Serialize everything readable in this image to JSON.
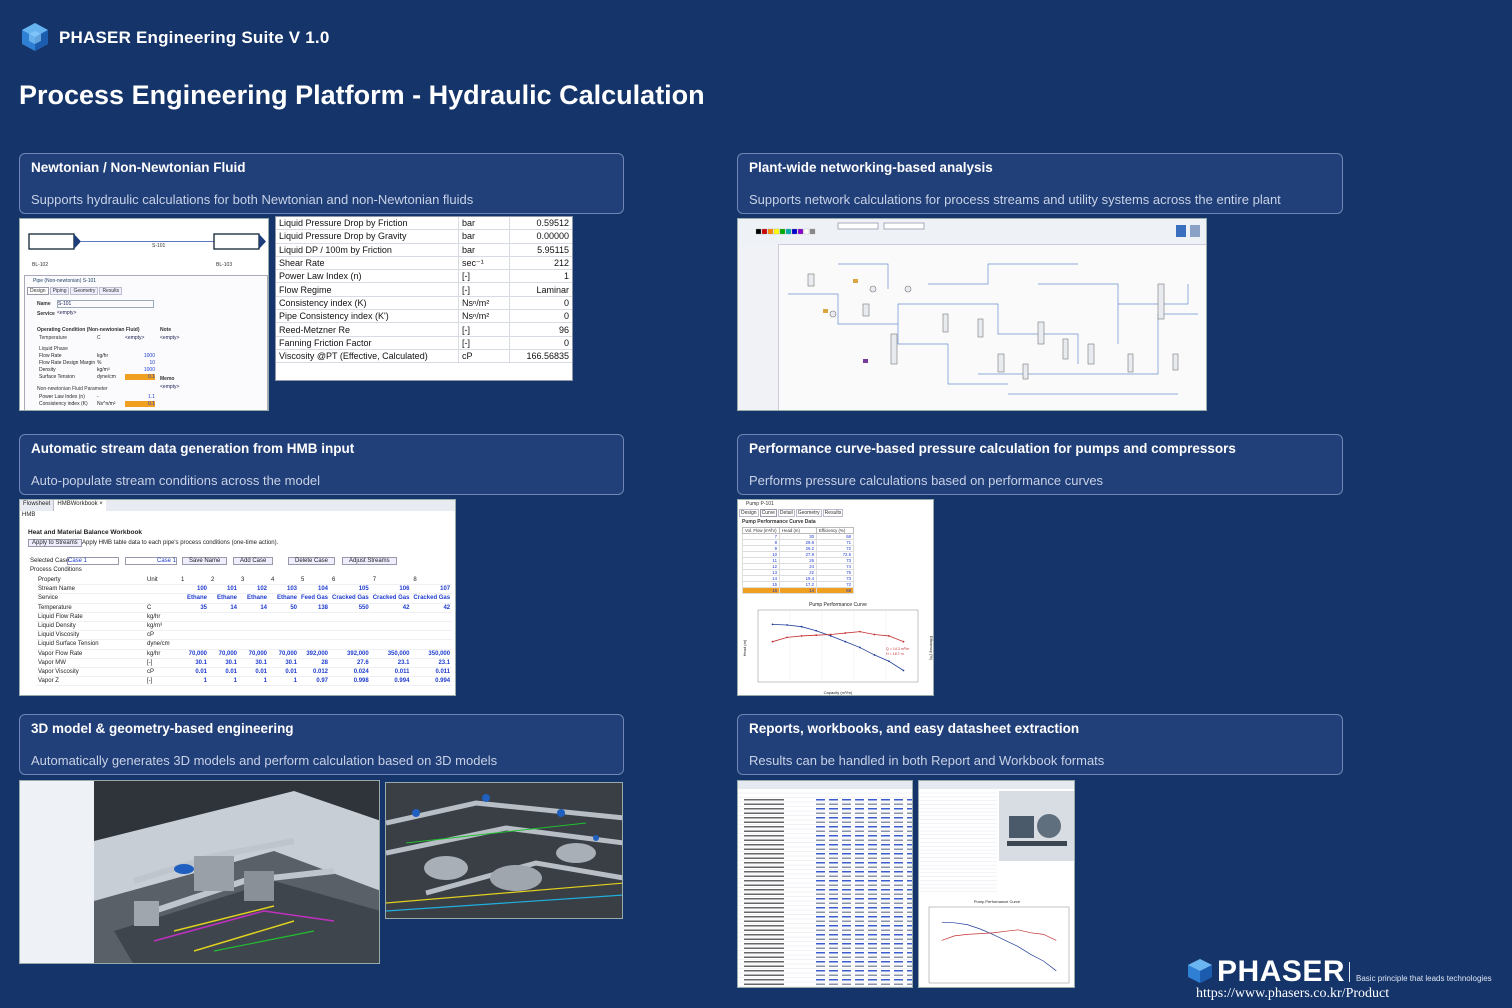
{
  "header": {
    "app_title": "PHASER Engineering Suite V 1.0",
    "page_title": "Process Engineering Platform - Hydraulic Calculation"
  },
  "cards": [
    {
      "title": "Newtonian / Non-Newtonian Fluid",
      "desc": "Supports hydraulic calculations for both Newtonian and non-Newtonian fluids"
    },
    {
      "title": "Plant-wide networking-based analysis",
      "desc": "Supports network calculations for process streams and utility systems across the entire plant"
    },
    {
      "title": "Automatic stream data generation from HMB input",
      "desc": "Auto-populate stream conditions across the model"
    },
    {
      "title": "Performance curve-based pressure calculation for pumps and compressors",
      "desc": "Performs pressure calculations based on performance curves"
    },
    {
      "title": "3D model & geometry-based engineering",
      "desc": "Automatically generates 3D models and perform calculation based on 3D models"
    },
    {
      "title": "Reports, workbooks, and easy datasheet extraction",
      "desc": "Results can be handled in both Report and Workbook formats"
    }
  ],
  "pipe_dialog": {
    "stream_left": "BL-102",
    "stream_right": "BL-103",
    "pipe_label": "S-101",
    "window_title": "Pipe (Non-newtonian) S-101",
    "tabs": [
      "Design",
      "Piping",
      "Geometry",
      "Results"
    ],
    "name_label": "Name",
    "name_value": "S-101",
    "service_label": "Service",
    "service_value": "<empty>",
    "section_operating": "Operating Condition (Non-newtonian Fluid)",
    "note_label": "Note",
    "note_value": "<empty>",
    "memo_label": "Memo",
    "memo_value": "<empty>",
    "temperature_label": "Temperature",
    "temperature_unit": "C",
    "temperature_value": "<empty>",
    "liquid_phase": "Liquid Phase",
    "rows": [
      {
        "label": "Flow Rate",
        "unit": "kg/hr",
        "value": "1000"
      },
      {
        "label": "Flow Rate Design Margin",
        "unit": "%",
        "value": "10"
      },
      {
        "label": "Density",
        "unit": "kg/m³",
        "value": "1000"
      },
      {
        "label": "Surface Tension",
        "unit": "dyne/cm",
        "value": "0.1"
      }
    ],
    "nn_section": "Non-newtonian Fluid Parameter",
    "nn_rows": [
      {
        "label": "Power Law Index (n)",
        "unit": "-",
        "value": "1.1"
      },
      {
        "label": "Consistency index (K)",
        "unit": "Ns^n/m²",
        "value": "0.1"
      }
    ]
  },
  "property_table": [
    {
      "name": "Liquid Pressure Drop by Friction",
      "unit": "bar",
      "value": "0.59512"
    },
    {
      "name": "Liquid Pressure Drop by Gravity",
      "unit": "bar",
      "value": "0.00000"
    },
    {
      "name": "Liquid DP / 100m by Friction",
      "unit": "bar",
      "value": "5.95115"
    },
    {
      "name": "Shear Rate",
      "unit": "sec⁻¹",
      "value": "212"
    },
    {
      "name": "Power Law Index (n)",
      "unit": "[-]",
      "value": "1"
    },
    {
      "name": "Flow Regime",
      "unit": "[-]",
      "value": "Laminar"
    },
    {
      "name": "Consistency index (K)",
      "unit": "Nsⁿ/m²",
      "value": "0"
    },
    {
      "name": "Pipe Consistency index (K')",
      "unit": "Nsⁿ/m²",
      "value": "0"
    },
    {
      "name": "Reed-Metzner Re",
      "unit": "[-]",
      "value": "96"
    },
    {
      "name": "Fanning Friction Factor",
      "unit": "[-]",
      "value": "0"
    },
    {
      "name": "Viscosity @PT (Effective, Calculated)",
      "unit": "cP",
      "value": "166.56835"
    }
  ],
  "hmb": {
    "tabs": [
      "Flowsheet",
      "HMBWorkbook ×"
    ],
    "subtab": "HMB",
    "title": "Heat and Material Balance Workbook",
    "apply_button": "Apply to Streams",
    "apply_note": "Apply HMB table data to each pipe's process conditions (one-time action).",
    "selected_case_label": "Selected Case",
    "selected_case": "Case 1",
    "case_name": "Case 1",
    "buttons": [
      "Save Name",
      "Add Case",
      "Delete Case",
      "Adjust Streams"
    ],
    "section": "Process Conditions",
    "header": [
      "Property",
      "Unit",
      "1",
      "2",
      "3",
      "4",
      "5",
      "6",
      "7",
      "8"
    ],
    "rows": [
      [
        "Stream Name",
        "",
        "100",
        "101",
        "102",
        "103",
        "104",
        "105",
        "106",
        "107"
      ],
      [
        "Service",
        "",
        "Ethane",
        "Ethane",
        "Ethane",
        "Ethane",
        "Feed Gas",
        "Cracked Gas",
        "Cracked Gas",
        "Cracked Gas"
      ],
      [
        "Temperature",
        "C",
        "35",
        "14",
        "14",
        "50",
        "138",
        "550",
        "42",
        "42"
      ],
      [
        "Liquid Flow Rate",
        "kg/hr",
        "",
        "",
        "",
        "",
        "",
        "",
        "",
        ""
      ],
      [
        "Liquid Density",
        "kg/m³",
        "",
        "",
        "",
        "",
        "",
        "",
        "",
        ""
      ],
      [
        "Liquid Viscosity",
        "cP",
        "",
        "",
        "",
        "",
        "",
        "",
        "",
        ""
      ],
      [
        "Liquid Surface Tension",
        "dyne/cm",
        "",
        "",
        "",
        "",
        "",
        "",
        "",
        ""
      ],
      [
        "Vapor Flow Rate",
        "kg/hr",
        "70,000",
        "70,000",
        "70,000",
        "70,000",
        "392,000",
        "392,000",
        "350,000",
        "350,000"
      ],
      [
        "Vapor MW",
        "[-]",
        "30.1",
        "30.1",
        "30.1",
        "30.1",
        "28",
        "27.6",
        "23.1",
        "23.1"
      ],
      [
        "Vapor Viscosity",
        "cP",
        "0.01",
        "0.01",
        "0.01",
        "0.01",
        "0.012",
        "0.024",
        "0.011",
        "0.011"
      ],
      [
        "Vapor Z",
        "[-]",
        "1",
        "1",
        "1",
        "1",
        "0.97",
        "0.998",
        "0.994",
        "0.994"
      ]
    ]
  },
  "pump": {
    "window_title": "Pump P-101",
    "tabs": [
      "Design",
      "Curve",
      "Detail",
      "Geometry",
      "Results"
    ],
    "table_title": "Pump Performance Curve Data",
    "col_headers": [
      "Vol. Flow (m³/hr)",
      "Head (m)",
      "Efficiency (%)"
    ],
    "table_rows": [
      [
        "7",
        "30",
        "68"
      ],
      [
        "8",
        "29.8",
        "71"
      ],
      [
        "9",
        "29.2",
        "72"
      ],
      [
        "10",
        "27.8",
        "72.5"
      ],
      [
        "11",
        "26",
        "73"
      ],
      [
        "12",
        "24",
        "74"
      ],
      [
        "13",
        "22",
        "75"
      ],
      [
        "14",
        "19.4",
        "73"
      ],
      [
        "15",
        "17.2",
        "72"
      ],
      [
        "16",
        "14",
        "68"
      ]
    ],
    "chart_title": "Pump Performance Curve",
    "x_label": "Capacity (m³/hr)",
    "y_label": "Head (m)",
    "y2_label": "Efficiency (%)",
    "annotation": "Q = 14.3 m³/hr\nH = 18.7 m"
  },
  "report": {
    "chart_title": "Pump Performance Curve"
  },
  "footer": {
    "brand": "PHASER",
    "tagline": "Basic principle that leads technologies",
    "url": "https://www.phasers.co.kr/Product"
  },
  "colors": {
    "background": "#14346a",
    "card_bg": "#213f78",
    "card_border": "#6f86b7",
    "accent_blue": "#2a8ad9",
    "curve_head": "#1f3c9a",
    "curve_eff": "#c43030"
  }
}
